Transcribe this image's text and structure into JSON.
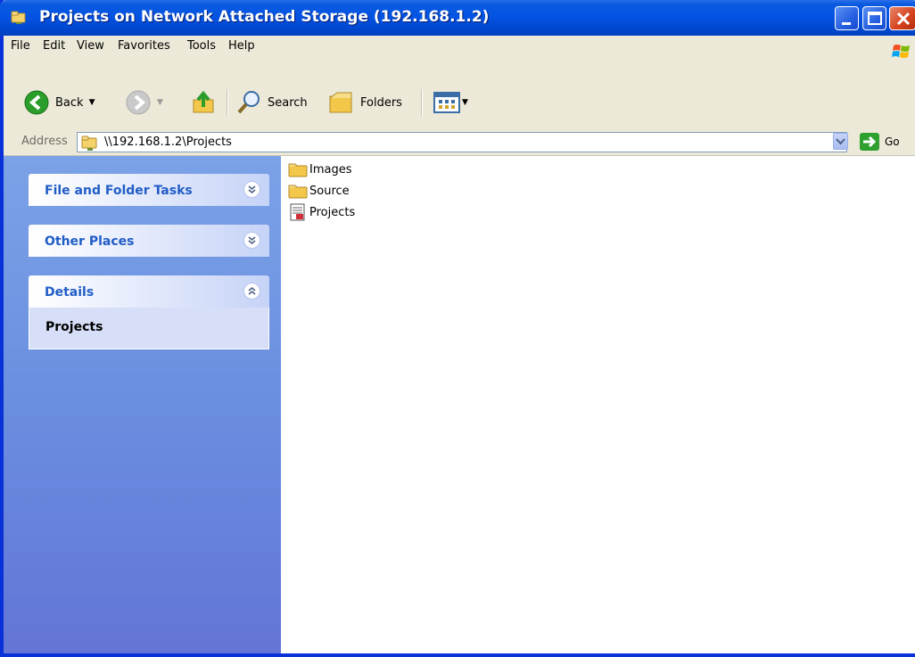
{
  "window": {
    "title": "Projects on Network Attached Storage (192.168.1.2)"
  },
  "menu": {
    "items": [
      "File",
      "Edit",
      "View",
      "Favorites",
      "Tools",
      "Help"
    ]
  },
  "toolbar": {
    "back_label": "Back",
    "search_label": "Search",
    "folders_label": "Folders"
  },
  "address": {
    "label": "Address",
    "value": "\\\\192.168.1.2\\Projects",
    "go_label": "Go"
  },
  "taskpane": {
    "panels": [
      {
        "title": "File and Folder Tasks",
        "state": "collapsed"
      },
      {
        "title": "Other Places",
        "state": "collapsed"
      },
      {
        "title": "Details",
        "state": "expanded",
        "body": "Projects"
      }
    ]
  },
  "files": [
    {
      "name": "Images",
      "type": "folder-icon"
    },
    {
      "name": "Source",
      "type": "folder-icon"
    },
    {
      "name": "Projects",
      "type": "document-icon"
    }
  ],
  "colors": {
    "titlebar": "#0454e3",
    "taskpane": "#6a8ee0",
    "panel_title": "#215dc6"
  }
}
